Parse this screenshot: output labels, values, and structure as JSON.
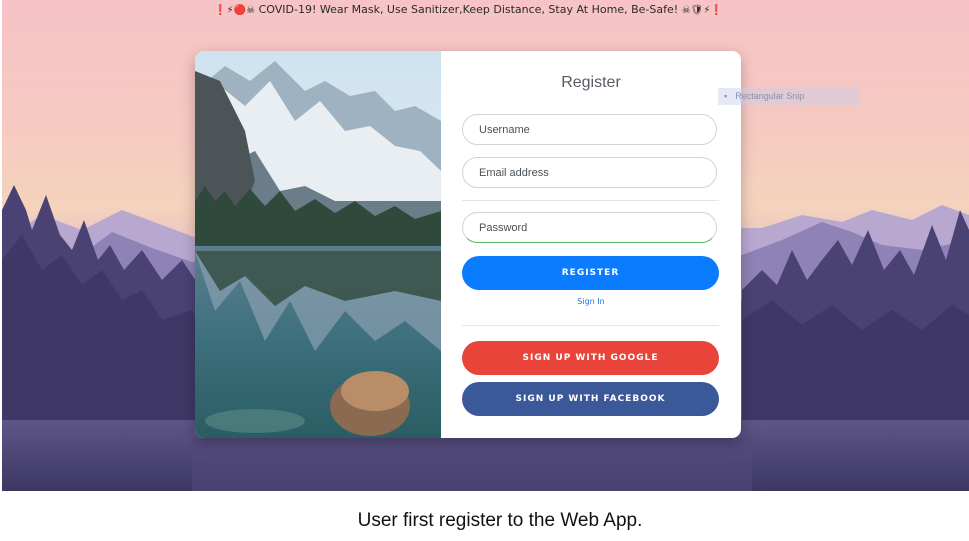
{
  "banner": {
    "prefix_icons": "❗⚡🔴☠",
    "text": "COVID-19! Wear Mask, Use Sanitizer,Keep Distance, Stay At Home, Be-Safe!",
    "suffix_icons": "☠🛡⚡❗"
  },
  "register_form": {
    "title": "Register",
    "username_placeholder": "Username",
    "email_placeholder": "Email address",
    "password_placeholder": "Password",
    "register_button": "REGISTER",
    "signin_link": "Sign In",
    "google_button": "SIGN UP WITH GOOGLE",
    "facebook_button": "SIGN UP WITH FACEBOOK"
  },
  "snip_overlay": {
    "label": "Rectangular Snip"
  },
  "caption": "User first register to the Web App.",
  "colors": {
    "register": "#0b7bff",
    "google": "#e8443a",
    "facebook": "#3b5998",
    "link": "#1a73e8"
  }
}
